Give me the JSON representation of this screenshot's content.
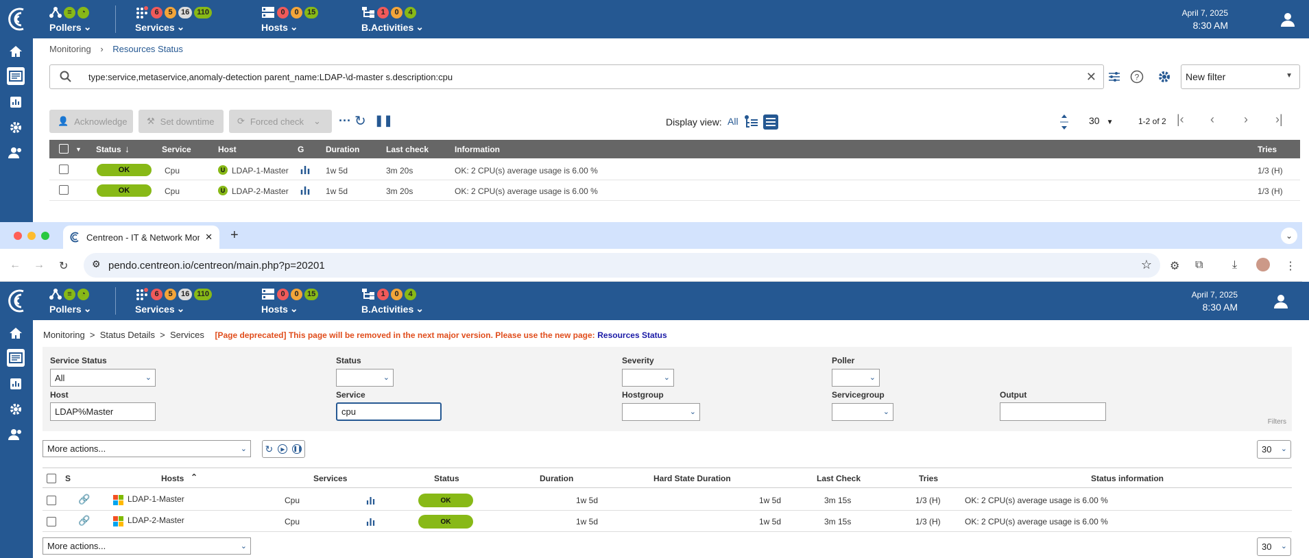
{
  "top_header": {
    "pollers": {
      "label": "Pollers"
    },
    "services": {
      "label": "Services",
      "counts": [
        "6",
        "5",
        "16",
        "110"
      ]
    },
    "hosts": {
      "label": "Hosts",
      "counts": [
        "0",
        "0",
        "15"
      ]
    },
    "bactivities": {
      "label": "B.Activities",
      "counts": [
        "1",
        "0",
        "4"
      ]
    },
    "date": "April 7, 2025",
    "time": "8:30 AM"
  },
  "resources_page": {
    "breadcrumb": {
      "parent": "Monitoring",
      "separator": ">",
      "current": "Resources Status"
    },
    "search_value": "type:service,metaservice,anomaly-detection parent_name:LDAP-\\d-master s.description:cpu",
    "filter_select": "New filter",
    "actions": {
      "acknowledge": "Acknowledge",
      "set_downtime": "Set downtime",
      "forced_check": "Forced check"
    },
    "display_view_label": "Display view:",
    "display_view_all": "All",
    "page_size": "30",
    "pagination": "1-2 of 2",
    "columns": [
      "Status",
      "Service",
      "Host",
      "G",
      "Duration",
      "Last check",
      "Information",
      "Tries"
    ],
    "rows": [
      {
        "status": "OK",
        "service": "Cpu",
        "host_badge": "U",
        "host": "LDAP-1-Master",
        "duration": "1w 5d",
        "last_check": "3m 20s",
        "information": "OK: 2 CPU(s) average usage is 6.00 %",
        "tries": "1/3 (H)"
      },
      {
        "status": "OK",
        "service": "Cpu",
        "host_badge": "U",
        "host": "LDAP-2-Master",
        "duration": "1w 5d",
        "last_check": "3m 20s",
        "information": "OK: 2 CPU(s) average usage is 6.00 %",
        "tries": "1/3 (H)"
      }
    ]
  },
  "browser": {
    "tab_title": "Centreon - IT & Network Mon",
    "url": "pendo.centreon.io/centreon/main.php?p=20201"
  },
  "legacy_page": {
    "breadcrumb": "Monitoring  >  Status Details  >  Services",
    "deprecation_notice": "[Page deprecated] This page will be removed in the next major version. Please use the new page:",
    "deprecation_link": "Resources Status",
    "filters": {
      "service_status_label": "Service Status",
      "service_status_value": "All",
      "status_label": "Status",
      "severity_label": "Severity",
      "poller_label": "Poller",
      "host_label": "Host",
      "host_value": "LDAP%Master",
      "service_label": "Service",
      "service_value": "cpu",
      "hostgroup_label": "Hostgroup",
      "servicegroup_label": "Servicegroup",
      "output_label": "Output",
      "filters_caption": "Filters"
    },
    "more_actions": "More actions...",
    "page_size": "30",
    "columns": [
      "S",
      "Hosts",
      "Services",
      "Status",
      "Duration",
      "Hard State Duration",
      "Last Check",
      "Tries",
      "Status information"
    ],
    "rows": [
      {
        "host": "LDAP-1-Master",
        "service": "Cpu",
        "status": "OK",
        "duration": "1w 5d",
        "hard_duration": "1w 5d",
        "last_check": "3m 15s",
        "tries": "1/3 (H)",
        "info": "OK: 2 CPU(s) average usage is 6.00 %"
      },
      {
        "host": "LDAP-2-Master",
        "service": "Cpu",
        "status": "OK",
        "duration": "1w 5d",
        "hard_duration": "1w 5d",
        "last_check": "3m 15s",
        "tries": "1/3 (H)",
        "info": "OK: 2 CPU(s) average usage is 6.00 %"
      }
    ]
  },
  "colors": {
    "brand": "#255892",
    "ok": "#88b917",
    "critical": "#f05a5a",
    "warning": "#f3a53a"
  }
}
